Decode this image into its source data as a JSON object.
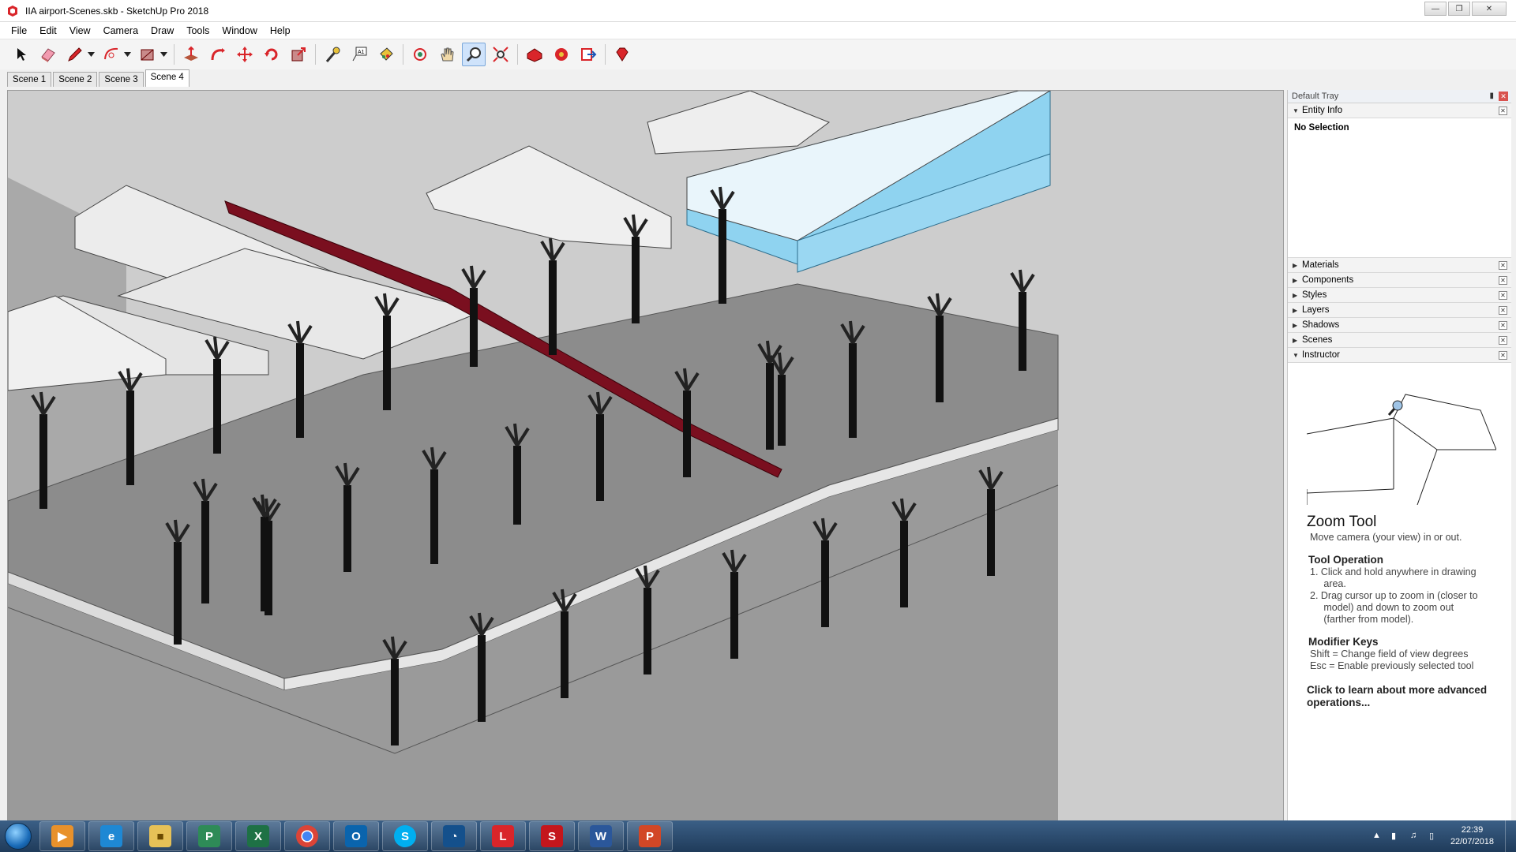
{
  "window": {
    "title": "IIA airport-Scenes.skb - SketchUp Pro 2018"
  },
  "menu": [
    "File",
    "Edit",
    "View",
    "Camera",
    "Draw",
    "Tools",
    "Window",
    "Help"
  ],
  "toolbar": {
    "tools": [
      "select-icon",
      "eraser-icon",
      "pencil-icon",
      "arc-icon",
      "rectangle-icon",
      "push-pull-icon",
      "follow-me-icon",
      "move-icon",
      "rotate-icon",
      "scale-icon",
      "tape-measure-icon",
      "text-icon",
      "paint-bucket-icon",
      "orbit-icon",
      "pan-icon",
      "zoom-icon",
      "zoom-extents-icon",
      "warehouse-icon",
      "extension-icon",
      "send-layout-icon",
      "ruby-icon"
    ],
    "active_tool": "zoom-icon"
  },
  "scenes": {
    "tabs": [
      "Scene 1",
      "Scene 2",
      "Scene 3",
      "Scene 4"
    ],
    "active": "Scene 4"
  },
  "tray": {
    "title": "Default Tray",
    "entity_info": {
      "label": "Entity Info",
      "selection": "No Selection"
    },
    "panels": [
      "Materials",
      "Components",
      "Styles",
      "Layers",
      "Shadows",
      "Scenes"
    ],
    "instructor": {
      "label": "Instructor",
      "tool_name": "Zoom Tool",
      "description": "Move camera (your view) in or out.",
      "operation_heading": "Tool Operation",
      "steps": [
        "1.  Click and hold anywhere in drawing",
        "     area.",
        "2.  Drag cursor up to zoom in (closer to",
        "     model) and down to zoom out",
        "     (farther from model)."
      ],
      "modifier_heading": "Modifier Keys",
      "modifiers": [
        "Shift = Change field of view degrees",
        "Esc = Enable previously selected tool"
      ],
      "link": "Click to learn about more advanced operations..."
    }
  },
  "taskbar": {
    "apps": [
      "media-player-icon",
      "internet-explorer-icon",
      "file-explorer-icon",
      "project-icon",
      "excel-icon",
      "chrome-icon",
      "outlook-icon",
      "skype-icon",
      "app-blue-icon",
      "layout-icon",
      "sketchup-icon",
      "word-icon",
      "powerpoint-icon"
    ],
    "time": "22:39",
    "date": "22/07/2018"
  },
  "colors": {
    "beam": "#7a0f1f",
    "slab": "#8c8c8c",
    "column": "#111111",
    "glass": "#8fd3f0"
  }
}
